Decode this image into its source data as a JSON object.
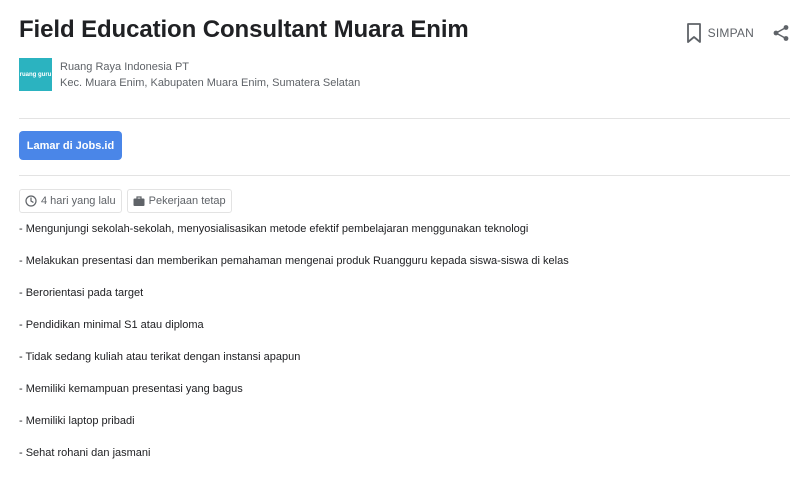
{
  "job": {
    "title": "Field Education Consultant Muara Enim"
  },
  "actions": {
    "save_label": "SIMPAN"
  },
  "company": {
    "logo_text": "ruang guru",
    "name": "Ruang Raya Indonesia PT",
    "location": "Kec. Muara Enim, Kabupaten Muara Enim, Sumatera Selatan"
  },
  "apply": {
    "label": "Lamar di Jobs.id"
  },
  "chips": {
    "posted": "4 hari yang lalu",
    "type": "Pekerjaan tetap"
  },
  "description": [
    "- Mengunjungi sekolah-sekolah, menyosialisasikan metode efektif pembelajaran menggunakan teknologi",
    "- Melakukan presentasi dan memberikan pemahaman mengenai produk Ruangguru kepada siswa-siswa di kelas",
    "- Berorientasi pada target",
    "- Pendidikan minimal S1 atau diploma",
    "- Tidak sedang kuliah atau terikat dengan instansi apapun",
    "- Memiliki kemampuan presentasi yang bagus",
    "- Memiliki laptop pribadi",
    "- Sehat rohani dan jasmani"
  ],
  "colors": {
    "apply_button": "#4a86e8",
    "logo_bg": "#2bb3c0"
  }
}
